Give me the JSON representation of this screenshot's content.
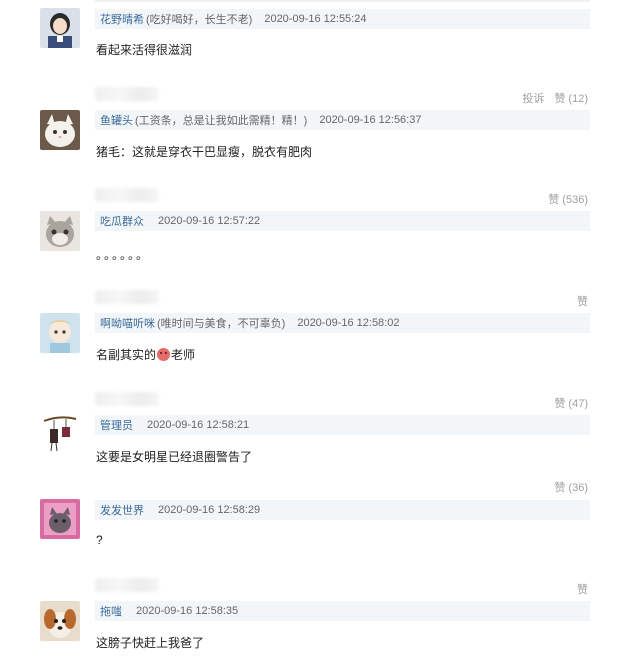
{
  "comments": [
    {
      "username": "花野晴希",
      "note": "(吃好喝好，长生不老)",
      "time": "2020-09-16 12:55:24",
      "text": "看起来活得很滋润",
      "report_label": "投诉",
      "like_label": "赞 (12)"
    },
    {
      "username": "鱼罐头",
      "note": "(工资条，总是让我如此需精！精！)",
      "time": "2020-09-16 12:56:37",
      "text": "猪毛：这就是穿衣干巴显瘦，脱衣有肥肉",
      "like_label": "赞 (536)"
    },
    {
      "username": "吃瓜群众",
      "note": "",
      "time": "2020-09-16 12:57:22",
      "text": "。。。。。。",
      "like_label": "赞"
    },
    {
      "username": "啊呦喵听咪",
      "note": "(唯时间与美食，不可辜负)",
      "time": "2020-09-16 12:58:02",
      "text_before": "名副其实的",
      "emoji": "pig-face-icon",
      "text_after": "老师",
      "like_label": "赞 (47)"
    },
    {
      "username": "管理员",
      "note": "",
      "time": "2020-09-16 12:58:21",
      "text": "这要是女明星已经退圈警告了",
      "like_label": "赞 (36)"
    },
    {
      "username": "发发世界",
      "note": "",
      "time": "2020-09-16 12:58:29",
      "text": "?",
      "like_label": "赞"
    },
    {
      "username": "拖嗤",
      "note": "",
      "time": "2020-09-16 12:58:35",
      "text": "这膀子快赶上我爸了"
    }
  ],
  "colors": {
    "username": "#3a6a99",
    "header_bg": "#f2f6f9",
    "muted": "#a0a0a0"
  }
}
